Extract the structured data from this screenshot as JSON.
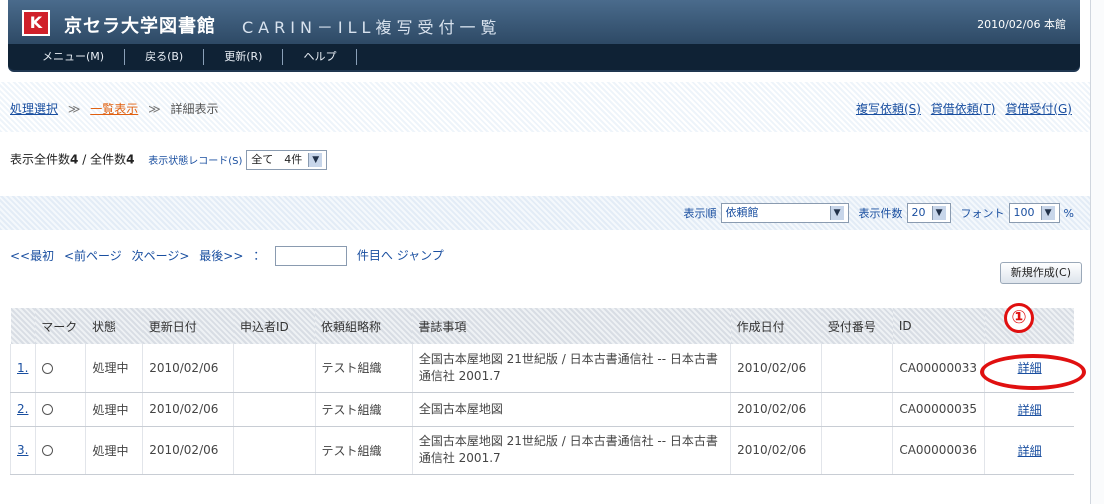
{
  "header": {
    "logo_glyph": "K",
    "org_name": "京セラ大学図書館",
    "title": "CARIN－ILL複写受付一覧",
    "date_branch": "2010/02/06 本館"
  },
  "menu": [
    {
      "label": "メニュー(M)"
    },
    {
      "label": "戻る(B)"
    },
    {
      "label": "更新(R)"
    },
    {
      "label": "ヘルプ"
    }
  ],
  "breadcrumb": {
    "items": [
      "処理選択",
      "一覧表示",
      "詳細表示"
    ],
    "sep": "≫"
  },
  "right_links": [
    "複写依頼(S)",
    "貸借依頼(T)",
    "貸借受付(G)"
  ],
  "counts": {
    "shown_label": "表示全件数",
    "shown_value": "4",
    "total_label": "全件数",
    "total_value": "4",
    "record_label": "表示状態レコード(S)",
    "record_select": "全て　4件"
  },
  "settings": {
    "order_label": "表示順",
    "order_value": "依頼館",
    "count_label": "表示件数",
    "count_value": "20",
    "font_label": "フォント",
    "font_value": "100",
    "font_unit": "%"
  },
  "pager": {
    "first": "<<最初",
    "prev": "<前ページ",
    "next": "次ページ>",
    "last": "最後>>",
    "colon": "：",
    "jump_suffix": "件目へ ジャンプ"
  },
  "new_button": "新規作成(C)",
  "table": {
    "columns": [
      "",
      "マーク",
      "状態",
      "更新日付",
      "申込者ID",
      "依頼組略称",
      "書誌事項",
      "作成日付",
      "受付番号",
      "ID",
      ""
    ],
    "rows": [
      {
        "no": "1.",
        "status": "処理中",
        "updated": "2010/02/06",
        "applicant": "",
        "org": "テスト組織",
        "biblio": "全国古本屋地図 21世紀版 / 日本古書通信社 -- 日本古書通信社 2001.7",
        "created": "2010/02/06",
        "receipt": "",
        "id": "CA00000033",
        "detail": "詳細"
      },
      {
        "no": "2.",
        "status": "処理中",
        "updated": "2010/02/06",
        "applicant": "",
        "org": "テスト組織",
        "biblio": "全国古本屋地図",
        "created": "2010/02/06",
        "receipt": "",
        "id": "CA00000035",
        "detail": "詳細"
      },
      {
        "no": "3.",
        "status": "処理中",
        "updated": "2010/02/06",
        "applicant": "",
        "org": "テスト組織",
        "biblio": "全国古本屋地図 21世紀版 / 日本古書通信社 -- 日本古書通信社 2001.7",
        "created": "2010/02/06",
        "receipt": "",
        "id": "CA00000036",
        "detail": "詳細"
      }
    ]
  },
  "annotation": {
    "marker": "①",
    "color": "#e01010"
  }
}
